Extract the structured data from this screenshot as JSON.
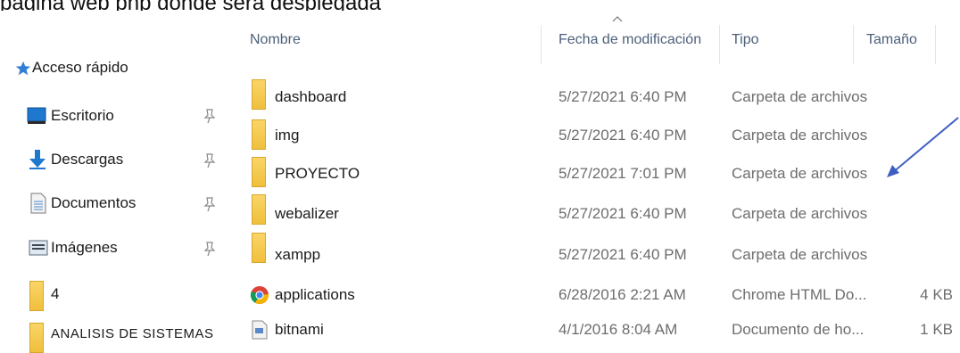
{
  "top_text": "página web php donde será desplegada",
  "nav": {
    "quick_access": {
      "label": "Acceso rápido",
      "icon": "star-icon"
    },
    "items": [
      {
        "label": "Escritorio",
        "icon": "desktop-icon",
        "pinned": true
      },
      {
        "label": "Descargas",
        "icon": "download-icon",
        "pinned": true
      },
      {
        "label": "Documentos",
        "icon": "document-icon",
        "pinned": true
      },
      {
        "label": "Imágenes",
        "icon": "picture-icon",
        "pinned": true
      },
      {
        "label": "4",
        "icon": "folder-icon",
        "pinned": false
      },
      {
        "label": "ANALISIS DE SISTEMAS",
        "icon": "folder-icon",
        "pinned": false
      }
    ]
  },
  "columns": {
    "name": "Nombre",
    "date": "Fecha de modificación",
    "type": "Tipo",
    "size": "Tamaño"
  },
  "rows": [
    {
      "name": "dashboard",
      "date": "5/27/2021 6:40 PM",
      "type": "Carpeta de archivos",
      "size": "",
      "icon": "folder-icon"
    },
    {
      "name": "img",
      "date": "5/27/2021 6:40 PM",
      "type": "Carpeta de archivos",
      "size": "",
      "icon": "folder-icon"
    },
    {
      "name": "PROYECTO",
      "date": "5/27/2021 7:01 PM",
      "type": "Carpeta de archivos",
      "size": "",
      "icon": "folder-icon"
    },
    {
      "name": "webalizer",
      "date": "5/27/2021 6:40 PM",
      "type": "Carpeta de archivos",
      "size": "",
      "icon": "folder-icon"
    },
    {
      "name": "xampp",
      "date": "5/27/2021 6:40 PM",
      "type": "Carpeta de archivos",
      "size": "",
      "icon": "folder-icon"
    },
    {
      "name": "applications",
      "date": "6/28/2016 2:21 AM",
      "type": "Chrome HTML Do...",
      "size": "4 KB",
      "icon": "chrome-icon"
    },
    {
      "name": "bitnami",
      "date": "4/1/2016 8:04 AM",
      "type": "Documento de ho...",
      "size": "1 KB",
      "icon": "css-file-icon"
    }
  ],
  "colors": {
    "accent_blue": "#0078d7",
    "folder_yellow": "#f6c744",
    "arrow": "#3d5fc4",
    "header_text": "#4c607a"
  }
}
